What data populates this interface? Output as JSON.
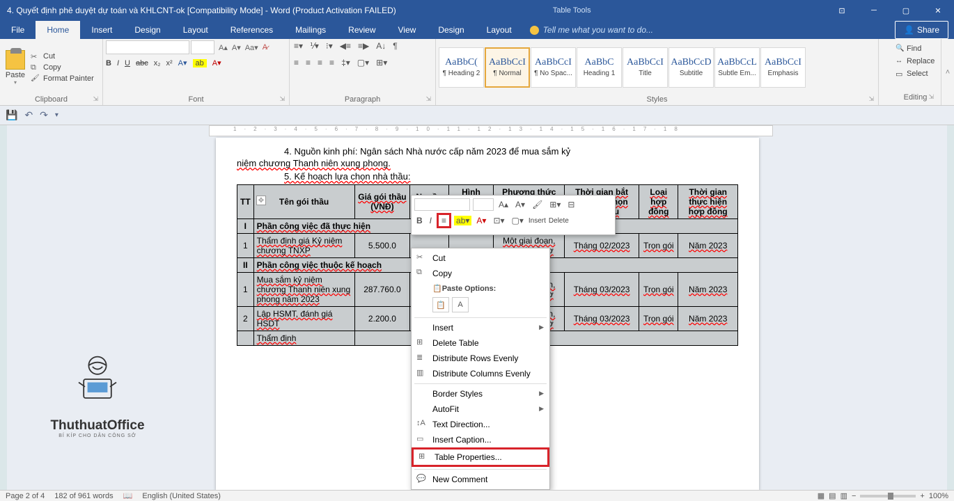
{
  "titlebar": {
    "title": "4. Quyết định phê duyệt dự toán và KHLCNT-ok [Compatibility Mode] - Word (Product Activation FAILED)",
    "table_tools": "Table Tools"
  },
  "window_controls": {
    "min": "─",
    "max": "▢",
    "close": "✕",
    "opts": "▾",
    "restore": "⊡"
  },
  "tabs": {
    "file": "File",
    "home": "Home",
    "insert": "Insert",
    "design": "Design",
    "layout": "Layout",
    "references": "References",
    "mailings": "Mailings",
    "review": "Review",
    "view": "View",
    "tt_design": "Design",
    "tt_layout": "Layout",
    "tellme": "Tell me what you want to do...",
    "share": "Share"
  },
  "clipboard": {
    "paste": "Paste",
    "cut": "Cut",
    "copy": "Copy",
    "format_painter": "Format Painter",
    "label": "Clipboard"
  },
  "font_group": {
    "label": "Font",
    "size": "",
    "bold": "B",
    "italic": "I",
    "underline": "U",
    "strike": "abc"
  },
  "para_group": {
    "label": "Paragraph"
  },
  "styles_group": {
    "label": "Styles",
    "tiles": [
      {
        "preview": "AaBbC(",
        "name": "¶ Heading 2"
      },
      {
        "preview": "AaBbCcI",
        "name": "¶ Normal"
      },
      {
        "preview": "AaBbCcI",
        "name": "¶ No Spac..."
      },
      {
        "preview": "AaBbC",
        "name": "Heading 1"
      },
      {
        "preview": "AaBbCcI",
        "name": "Title"
      },
      {
        "preview": "AaBbCcD",
        "name": "Subtitle"
      },
      {
        "preview": "AaBbCcL",
        "name": "Subtle Em..."
      },
      {
        "preview": "AaBbCcI",
        "name": "Emphasis"
      }
    ]
  },
  "editing_group": {
    "label": "Editing",
    "find": "Find",
    "replace": "Replace",
    "select": "Select"
  },
  "document": {
    "p1_a": "4. Nguồn kinh phí: Ngân sách Nhà nước cấp năm 2023 để mua sắm kỷ",
    "p1_b": "niệm chương Thanh niên xung phong.",
    "p2": "5. Kế hoạch lựa chọn nhà thầu:",
    "headers": {
      "tt": "TT",
      "ten": "Tên gói thầu",
      "gia": "Giá gói thầu (VNĐ)",
      "nguon": "Nguồn vốn",
      "hinhthuc": "Hình thức lựa chọn",
      "phuongth": "Phương thức lựa chọn nhà thầu",
      "thoigian1": "Thời gian bắt đầu lựa chọn nhà thầu",
      "loai": "Loại hợp đồng",
      "thoigian2": "Thời gian thực hiện hợp đồng"
    },
    "row_h1": {
      "tt": "I",
      "ten": "Phần công việc đã thực hiện"
    },
    "row1": {
      "tt": "1",
      "ten": "Thẩm định giá Kỷ niệm chương TNXP",
      "gia": "5.500.0",
      "phuongth": "Một giai đoạn, một túi hồ sơ",
      "tg": "Tháng 02/2023",
      "loai": "Trọn gói",
      "tg2": "Năm 2023"
    },
    "row_h2": {
      "tt": "II",
      "ten": "Phần công việc thuộc kế hoạch"
    },
    "row2": {
      "tt": "1",
      "ten": "Mua sắm kỷ niệm chương Thanh niên xung phong năm 2023",
      "gia": "287.760.0",
      "phuongth": "Một giai đoạn, một túi hồ sơ",
      "tg": "Tháng 03/2023",
      "loai": "Trọn gói",
      "tg2": "Năm 2023"
    },
    "row3": {
      "tt": "2",
      "ten": "Lập HSMT, đánh giá HSDT",
      "gia": "2.200.0",
      "phuongth": "Một giai đoạn, một túi hồ sơ",
      "tg": "Tháng 03/2023",
      "loai": "Trọn gói",
      "tg2": "Năm 2023"
    },
    "row4": {
      "ten": "Thẩm định"
    }
  },
  "mini_toolbar": {
    "insert": "Insert",
    "delete": "Delete"
  },
  "context_menu": {
    "cut": "Cut",
    "copy": "Copy",
    "paste_options": "Paste Options:",
    "insert": "Insert",
    "delete_table": "Delete Table",
    "dist_rows": "Distribute Rows Evenly",
    "dist_cols": "Distribute Columns Evenly",
    "border_styles": "Border Styles",
    "autofit": "AutoFit",
    "text_dir": "Text Direction...",
    "caption": "Insert Caption...",
    "props": "Table Properties...",
    "new_comment": "New Comment"
  },
  "watermark": {
    "text": "ThuthuatOffice",
    "sub": "BÍ KÍP CHO DÂN CÔNG SỞ"
  },
  "statusbar": {
    "page": "Page 2 of 4",
    "words": "182 of 961 words",
    "lang": "English (United States)",
    "zoom": "100%"
  },
  "ruler_h": "1·2·3·4·5·6·7·8·9·10·11·12·13·14·15·16·17·18"
}
